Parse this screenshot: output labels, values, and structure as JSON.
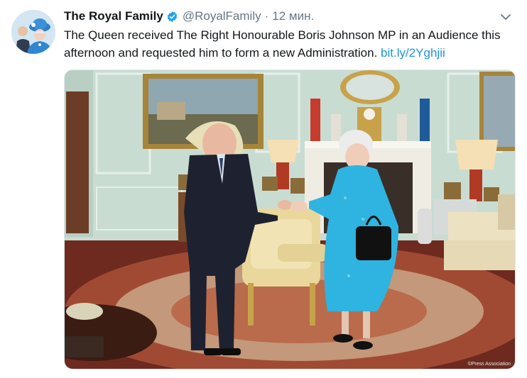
{
  "tweet": {
    "author_name": "The Royal Family",
    "handle": "@RoyalFamily",
    "separator": "·",
    "time": "12 мин.",
    "text": "The Queen received The Right Honourable Boris Johnson MP in an Audience this afternoon and requested him to form a new Administration.",
    "link": "bit.ly/2Yghjii",
    "photo_credit": "©Press Association",
    "icons": {
      "verified": "verified-badge-icon",
      "menu": "chevron-down-icon"
    },
    "colors": {
      "text": "#14171a",
      "secondary": "#657786",
      "link": "#1b95e0",
      "verified": "#1da1f2"
    }
  }
}
